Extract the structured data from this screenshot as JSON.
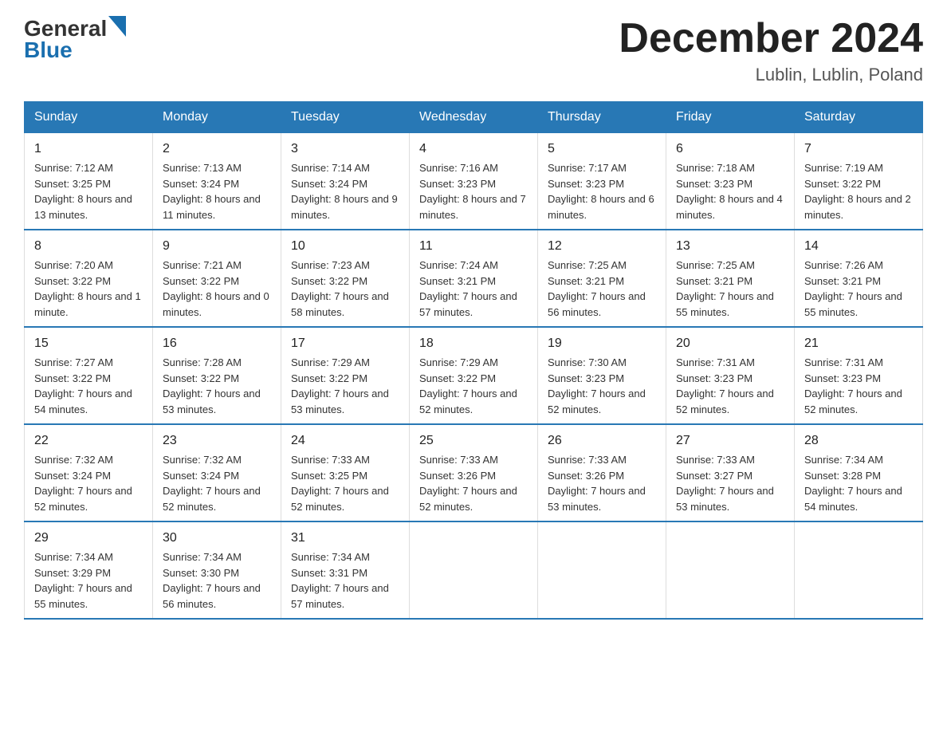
{
  "header": {
    "logo_general": "General",
    "logo_blue": "Blue",
    "month_title": "December 2024",
    "location": "Lublin, Lublin, Poland"
  },
  "days_of_week": [
    "Sunday",
    "Monday",
    "Tuesday",
    "Wednesday",
    "Thursday",
    "Friday",
    "Saturday"
  ],
  "weeks": [
    [
      {
        "day": "1",
        "sunrise": "7:12 AM",
        "sunset": "3:25 PM",
        "daylight": "8 hours and 13 minutes."
      },
      {
        "day": "2",
        "sunrise": "7:13 AM",
        "sunset": "3:24 PM",
        "daylight": "8 hours and 11 minutes."
      },
      {
        "day": "3",
        "sunrise": "7:14 AM",
        "sunset": "3:24 PM",
        "daylight": "8 hours and 9 minutes."
      },
      {
        "day": "4",
        "sunrise": "7:16 AM",
        "sunset": "3:23 PM",
        "daylight": "8 hours and 7 minutes."
      },
      {
        "day": "5",
        "sunrise": "7:17 AM",
        "sunset": "3:23 PM",
        "daylight": "8 hours and 6 minutes."
      },
      {
        "day": "6",
        "sunrise": "7:18 AM",
        "sunset": "3:23 PM",
        "daylight": "8 hours and 4 minutes."
      },
      {
        "day": "7",
        "sunrise": "7:19 AM",
        "sunset": "3:22 PM",
        "daylight": "8 hours and 2 minutes."
      }
    ],
    [
      {
        "day": "8",
        "sunrise": "7:20 AM",
        "sunset": "3:22 PM",
        "daylight": "8 hours and 1 minute."
      },
      {
        "day": "9",
        "sunrise": "7:21 AM",
        "sunset": "3:22 PM",
        "daylight": "8 hours and 0 minutes."
      },
      {
        "day": "10",
        "sunrise": "7:23 AM",
        "sunset": "3:22 PM",
        "daylight": "7 hours and 58 minutes."
      },
      {
        "day": "11",
        "sunrise": "7:24 AM",
        "sunset": "3:21 PM",
        "daylight": "7 hours and 57 minutes."
      },
      {
        "day": "12",
        "sunrise": "7:25 AM",
        "sunset": "3:21 PM",
        "daylight": "7 hours and 56 minutes."
      },
      {
        "day": "13",
        "sunrise": "7:25 AM",
        "sunset": "3:21 PM",
        "daylight": "7 hours and 55 minutes."
      },
      {
        "day": "14",
        "sunrise": "7:26 AM",
        "sunset": "3:21 PM",
        "daylight": "7 hours and 55 minutes."
      }
    ],
    [
      {
        "day": "15",
        "sunrise": "7:27 AM",
        "sunset": "3:22 PM",
        "daylight": "7 hours and 54 minutes."
      },
      {
        "day": "16",
        "sunrise": "7:28 AM",
        "sunset": "3:22 PM",
        "daylight": "7 hours and 53 minutes."
      },
      {
        "day": "17",
        "sunrise": "7:29 AM",
        "sunset": "3:22 PM",
        "daylight": "7 hours and 53 minutes."
      },
      {
        "day": "18",
        "sunrise": "7:29 AM",
        "sunset": "3:22 PM",
        "daylight": "7 hours and 52 minutes."
      },
      {
        "day": "19",
        "sunrise": "7:30 AM",
        "sunset": "3:23 PM",
        "daylight": "7 hours and 52 minutes."
      },
      {
        "day": "20",
        "sunrise": "7:31 AM",
        "sunset": "3:23 PM",
        "daylight": "7 hours and 52 minutes."
      },
      {
        "day": "21",
        "sunrise": "7:31 AM",
        "sunset": "3:23 PM",
        "daylight": "7 hours and 52 minutes."
      }
    ],
    [
      {
        "day": "22",
        "sunrise": "7:32 AM",
        "sunset": "3:24 PM",
        "daylight": "7 hours and 52 minutes."
      },
      {
        "day": "23",
        "sunrise": "7:32 AM",
        "sunset": "3:24 PM",
        "daylight": "7 hours and 52 minutes."
      },
      {
        "day": "24",
        "sunrise": "7:33 AM",
        "sunset": "3:25 PM",
        "daylight": "7 hours and 52 minutes."
      },
      {
        "day": "25",
        "sunrise": "7:33 AM",
        "sunset": "3:26 PM",
        "daylight": "7 hours and 52 minutes."
      },
      {
        "day": "26",
        "sunrise": "7:33 AM",
        "sunset": "3:26 PM",
        "daylight": "7 hours and 53 minutes."
      },
      {
        "day": "27",
        "sunrise": "7:33 AM",
        "sunset": "3:27 PM",
        "daylight": "7 hours and 53 minutes."
      },
      {
        "day": "28",
        "sunrise": "7:34 AM",
        "sunset": "3:28 PM",
        "daylight": "7 hours and 54 minutes."
      }
    ],
    [
      {
        "day": "29",
        "sunrise": "7:34 AM",
        "sunset": "3:29 PM",
        "daylight": "7 hours and 55 minutes."
      },
      {
        "day": "30",
        "sunrise": "7:34 AM",
        "sunset": "3:30 PM",
        "daylight": "7 hours and 56 minutes."
      },
      {
        "day": "31",
        "sunrise": "7:34 AM",
        "sunset": "3:31 PM",
        "daylight": "7 hours and 57 minutes."
      },
      null,
      null,
      null,
      null
    ]
  ]
}
